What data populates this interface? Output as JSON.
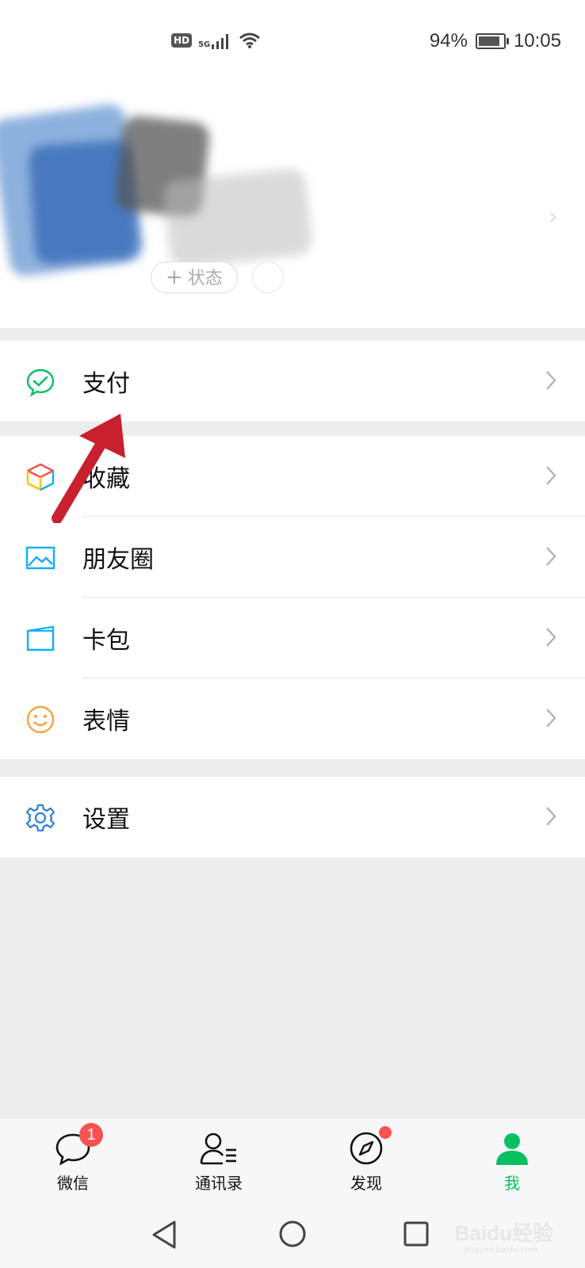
{
  "status_bar": {
    "hd": "HD",
    "network": "5G",
    "battery": "94%",
    "battery_level": 0.94,
    "time": "10:05"
  },
  "profile": {
    "status_button": "状态",
    "status_plus": "+"
  },
  "menu": {
    "pay": "支付",
    "favorites": "收藏",
    "moments": "朋友圈",
    "cards": "卡包",
    "stickers": "表情",
    "settings": "设置"
  },
  "tabbar": {
    "tabs": [
      {
        "label": "微信",
        "icon": "chat-bubble-icon",
        "badge": "1"
      },
      {
        "label": "通讯录",
        "icon": "contacts-icon"
      },
      {
        "label": "发现",
        "icon": "compass-icon"
      },
      {
        "label": "我",
        "icon": "person-icon"
      }
    ],
    "active_color": "#07c160"
  },
  "watermark": {
    "brand": "Baidu经验",
    "url": "jingyan.baidu.com"
  },
  "colors": {
    "accent_green": "#07c160",
    "badge_red": "#fa5151",
    "annotation_arrow": "#c8202f"
  }
}
